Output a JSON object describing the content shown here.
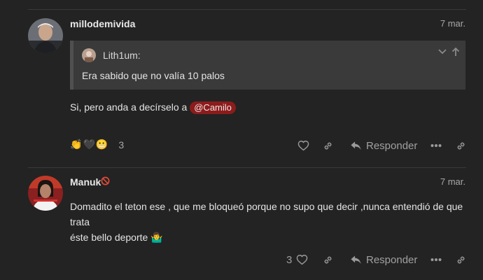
{
  "posts": [
    {
      "username": "millodemivida",
      "date": "7 mar.",
      "quote": {
        "author": "Lith1um:",
        "text": "Era sabido que no valía 10 palos"
      },
      "body_prefix": "Si, pero anda a decírselo a",
      "mention": "@Camilo",
      "reaction_emojis": [
        "👏",
        "🖤",
        "😬"
      ],
      "reaction_count": "3",
      "reply_label": "Responder"
    },
    {
      "username": "Manuk",
      "date": "7 mar.",
      "body_line1": "Domadito el teton ese , que me bloqueó porque no supo que decir ,nunca entendió de que trata",
      "body_line2": "éste bello deporte",
      "body_emoji": "🤷‍♂️",
      "like_count": "3",
      "reply_label": "Responder"
    }
  ],
  "icons": {
    "like": "heart-icon",
    "link": "link-icon",
    "reply": "reply-arrow-icon",
    "more": "ellipsis-icon",
    "share": "share-link-icon",
    "collapse": "chevron-down-icon",
    "expand": "arrow-up-icon",
    "restricted": "prohibited-icon"
  },
  "colors": {
    "background": "#232323",
    "quote_bg": "#3a3a3a",
    "mention_bg": "#8c1c1c",
    "muted_text": "#a8a8a8"
  }
}
